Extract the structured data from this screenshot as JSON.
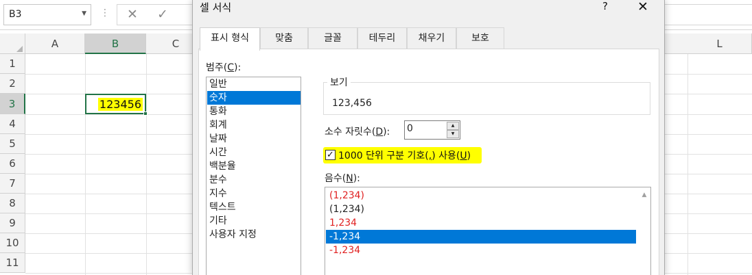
{
  "excel": {
    "name_box": "B3",
    "column_headers": [
      "A",
      "B",
      "C",
      "L"
    ],
    "row_headers": [
      "1",
      "2",
      "3",
      "4",
      "5",
      "6",
      "7",
      "8",
      "9",
      "10",
      "11"
    ],
    "cell_b3_value": "123456"
  },
  "dialog": {
    "title": "셀 서식",
    "help": "?",
    "close": "✕",
    "tabs": [
      "표시 형식",
      "맞춤",
      "글꼴",
      "테두리",
      "채우기",
      "보호"
    ],
    "category_label_prefix": "범주(",
    "category_label_key": "C",
    "category_label_suffix": "):",
    "categories": [
      "일반",
      "숫자",
      "통화",
      "회계",
      "날짜",
      "시간",
      "백분율",
      "분수",
      "지수",
      "텍스트",
      "기타",
      "사용자 지정"
    ],
    "selected_category": "숫자",
    "preview_label": "보기",
    "preview_value": "123,456",
    "decimal_label_prefix": "소수 자릿수(",
    "decimal_label_key": "D",
    "decimal_label_suffix": "):",
    "decimal_value": "0",
    "thousands_label_a": "1000 단위 구분 기호(",
    "thousands_label_b": ",",
    "thousands_label_c": ") 사용(",
    "thousands_label_d": "U",
    "thousands_label_e": ")",
    "thousands_checked": true,
    "negative_label_prefix": "음수(",
    "negative_label_key": "N",
    "negative_label_suffix": "):",
    "negative_formats": [
      {
        "text": "(1,234)",
        "color": "#e02020"
      },
      {
        "text": "(1,234)",
        "color": "#222222"
      },
      {
        "text": "1,234",
        "color": "#e02020"
      },
      {
        "text": "-1,234",
        "color": "#222222"
      },
      {
        "text": "-1,234",
        "color": "#e02020"
      }
    ],
    "selected_negative_index": 3
  },
  "colors": {
    "highlight": "#ffff00",
    "selection": "#0078d7",
    "excel_green": "#217346",
    "negative_red": "#e02020"
  }
}
